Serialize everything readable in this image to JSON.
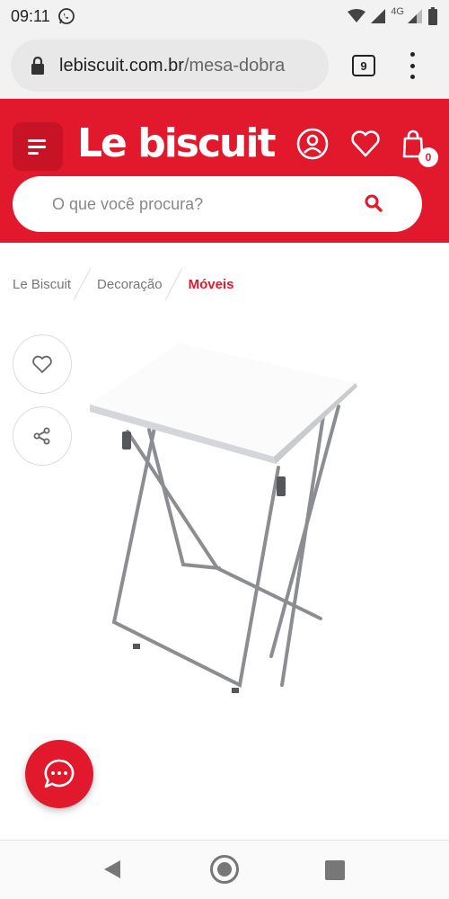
{
  "status_bar": {
    "time": "09:11",
    "network_label": "4G",
    "icons": [
      "whatsapp-icon",
      "wifi-icon",
      "signal-icon",
      "battery-icon"
    ]
  },
  "browser": {
    "url_domain": "lebiscuit.com.br",
    "url_path": "/mesa-dobra",
    "tab_count": "9",
    "icons": [
      "lock-icon",
      "menu-dots-icon"
    ]
  },
  "header": {
    "logo": "Le biscuit",
    "cart_count": "0",
    "search": {
      "placeholder": "O que você procura?"
    },
    "colors": {
      "brand_red": "#e2182d",
      "menu_bg": "#c81326"
    },
    "icons": [
      "hamburger-icon",
      "account-icon",
      "heart-icon",
      "bag-icon",
      "search-icon"
    ]
  },
  "breadcrumb": {
    "items": [
      "Le Biscuit",
      "Decoração"
    ],
    "current": "Móveis",
    "current_color": "#e2182d"
  },
  "product": {
    "actions": [
      "heart-icon",
      "share-icon"
    ]
  },
  "chat": {
    "icon": "chat-bubble-icon"
  },
  "nav_bar": {
    "icons": [
      "back-icon",
      "home-icon",
      "recents-icon"
    ]
  }
}
